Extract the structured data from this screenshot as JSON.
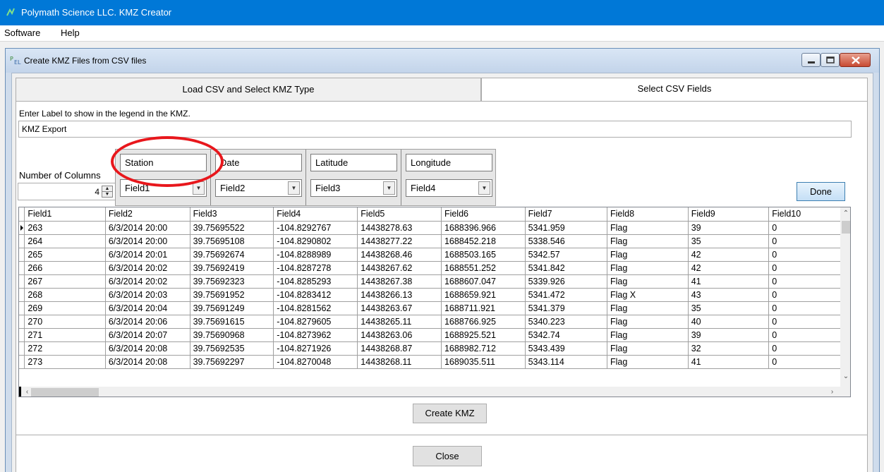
{
  "app": {
    "title": "Polymath Science LLC. KMZ Creator",
    "menu": [
      "Software",
      "Help"
    ]
  },
  "child_window": {
    "title": "Create KMZ Files from CSV files"
  },
  "tabs": [
    {
      "label": "Load CSV and Select KMZ Type",
      "active": false
    },
    {
      "label": "Select CSV Fields",
      "active": true
    }
  ],
  "legend": {
    "label": "Enter Label to show in the legend in the KMZ.",
    "value": "KMZ Export"
  },
  "columns": {
    "label": "Number of Columns",
    "value": "4"
  },
  "field_mapping": [
    {
      "name": "Station",
      "selected": "Field1"
    },
    {
      "name": "Date",
      "selected": "Field2"
    },
    {
      "name": "Latitude",
      "selected": "Field3"
    },
    {
      "name": "Longitude",
      "selected": "Field4"
    }
  ],
  "buttons": {
    "done": "Done",
    "create_kmz": "Create KMZ",
    "close": "Close"
  },
  "grid": {
    "headers": [
      "Field1",
      "Field2",
      "Field3",
      "Field4",
      "Field5",
      "Field6",
      "Field7",
      "Field8",
      "Field9",
      "Field10"
    ],
    "rows": [
      [
        "263",
        "6/3/2014 20:00",
        "39.75695522",
        "-104.8292767",
        "14438278.63",
        "1688396.966",
        "5341.959",
        "Flag",
        "39",
        "0"
      ],
      [
        "264",
        "6/3/2014 20:00",
        "39.75695108",
        "-104.8290802",
        "14438277.22",
        "1688452.218",
        "5338.546",
        "Flag",
        "35",
        "0"
      ],
      [
        "265",
        "6/3/2014 20:01",
        "39.75692674",
        "-104.8288989",
        "14438268.46",
        "1688503.165",
        "5342.57",
        "Flag",
        "42",
        "0"
      ],
      [
        "266",
        "6/3/2014 20:02",
        "39.75692419",
        "-104.8287278",
        "14438267.62",
        "1688551.252",
        "5341.842",
        "Flag",
        "42",
        "0"
      ],
      [
        "267",
        "6/3/2014 20:02",
        "39.75692323",
        "-104.8285293",
        "14438267.38",
        "1688607.047",
        "5339.926",
        "Flag",
        "41",
        "0"
      ],
      [
        "268",
        "6/3/2014 20:03",
        "39.75691952",
        "-104.8283412",
        "14438266.13",
        "1688659.921",
        "5341.472",
        "Flag X",
        "43",
        "0"
      ],
      [
        "269",
        "6/3/2014 20:04",
        "39.75691249",
        "-104.8281562",
        "14438263.67",
        "1688711.921",
        "5341.379",
        "Flag",
        "35",
        "0"
      ],
      [
        "270",
        "6/3/2014 20:06",
        "39.75691615",
        "-104.8279605",
        "14438265.11",
        "1688766.925",
        "5340.223",
        "Flag",
        "40",
        "0"
      ],
      [
        "271",
        "6/3/2014 20:07",
        "39.75690968",
        "-104.8273962",
        "14438263.06",
        "1688925.521",
        "5342.74",
        "Flag",
        "39",
        "0"
      ],
      [
        "272",
        "6/3/2014 20:08",
        "39.75692535",
        "-104.8271926",
        "14438268.87",
        "1688982.712",
        "5343.439",
        "Flag",
        "32",
        "0"
      ],
      [
        "273",
        "6/3/2014 20:08",
        "39.75692297",
        "-104.8270048",
        "14438268.11",
        "1689035.511",
        "5343.114",
        "Flag",
        "41",
        "0"
      ]
    ]
  }
}
